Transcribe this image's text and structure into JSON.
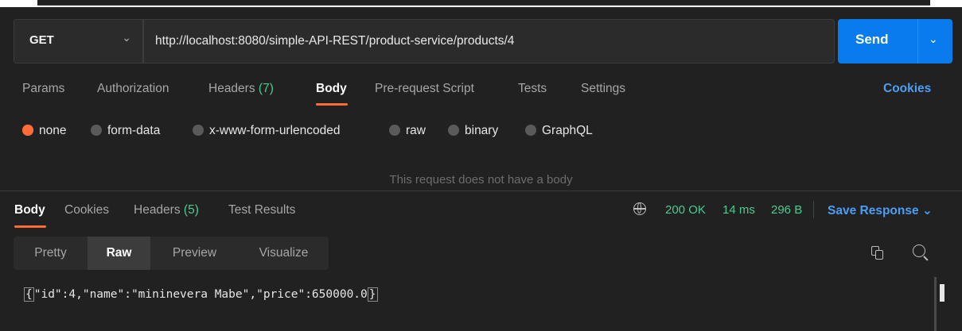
{
  "request": {
    "method": "GET",
    "url": "http://localhost:8080/simple-API-REST/product-service/products/4",
    "send_label": "Send"
  },
  "request_tabs": [
    {
      "label": "Params"
    },
    {
      "label": "Authorization"
    },
    {
      "label": "Headers",
      "count": "(7)"
    },
    {
      "label": "Body"
    },
    {
      "label": "Pre-request Script"
    },
    {
      "label": "Tests"
    },
    {
      "label": "Settings"
    }
  ],
  "cookies_label": "Cookies",
  "body_types": [
    "none",
    "form-data",
    "x-www-form-urlencoded",
    "raw",
    "binary",
    "GraphQL"
  ],
  "body_selected": "none",
  "no_body_message": "This request does not have a body",
  "response": {
    "tabs": [
      {
        "label": "Body"
      },
      {
        "label": "Cookies"
      },
      {
        "label": "Headers",
        "count": "(5)"
      },
      {
        "label": "Test Results"
      }
    ],
    "status": "200 OK",
    "time": "14 ms",
    "size": "296 B",
    "save_label": "Save Response",
    "format_tabs": [
      "Pretty",
      "Raw",
      "Preview",
      "Visualize"
    ],
    "format_selected": "Raw",
    "body_open": "{",
    "body_inner": "\"id\":4,\"name\":\"mininevera Mabe\",\"price\":650000.0",
    "body_close": "}"
  },
  "colors": {
    "accent": "#ff6c37",
    "send": "#097bed",
    "link": "#4a9ff5",
    "success": "#49cc90"
  }
}
